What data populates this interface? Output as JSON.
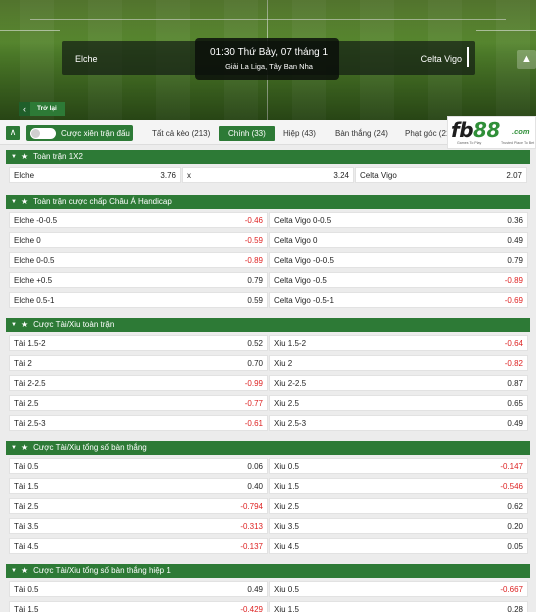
{
  "match": {
    "home_team": "Elche",
    "away_team": "Celta Vigo",
    "kickoff": "01:30 Thứ Bảy, 07 tháng 1",
    "league": "Giải La Liga, Tây Ban Nha"
  },
  "back_label": "Trở lại",
  "combo_toggle": {
    "label": "Cược xiên trận đấu",
    "on": false
  },
  "tabs": [
    {
      "label": "Tất cả kèo (213)",
      "active": false
    },
    {
      "label": "Chính (33)",
      "active": true
    },
    {
      "label": "Hiệp (43)",
      "active": false
    },
    {
      "label": "Bàn thắng (24)",
      "active": false
    },
    {
      "label": "Phạt góc (21",
      "active": false
    }
  ],
  "logo": {
    "fb": "fb",
    "num": "88",
    "com": ".com",
    "tag_left": "Games To Play",
    "tag_right": "Trusted Place To Bet"
  },
  "colors": {
    "accent": "#2d7a36",
    "negative": "#d22222"
  },
  "sections": [
    {
      "title": "Toàn trận 1X2",
      "columns": 3,
      "rows": [
        [
          {
            "label": "Elche",
            "odd": "3.76"
          },
          {
            "label": "x",
            "odd": "3.24"
          },
          {
            "label": "Celta Vigo",
            "odd": "2.07"
          }
        ]
      ]
    },
    {
      "title": "Toàn trận cược chấp Châu Á Handicap",
      "columns": 2,
      "rows": [
        [
          {
            "label": "Elche -0-0.5",
            "odd": "-0.46"
          },
          {
            "label": "Celta Vigo 0-0.5",
            "odd": "0.36"
          }
        ],
        [
          {
            "label": "Elche 0",
            "odd": "-0.59"
          },
          {
            "label": "Celta Vigo 0",
            "odd": "0.49"
          }
        ],
        [
          {
            "label": "Elche 0-0.5",
            "odd": "-0.89"
          },
          {
            "label": "Celta Vigo -0-0.5",
            "odd": "0.79"
          }
        ],
        [
          {
            "label": "Elche +0.5",
            "odd": "0.79"
          },
          {
            "label": "Celta Vigo -0.5",
            "odd": "-0.89"
          }
        ],
        [
          {
            "label": "Elche 0.5-1",
            "odd": "0.59"
          },
          {
            "label": "Celta Vigo -0.5-1",
            "odd": "-0.69"
          }
        ]
      ]
    },
    {
      "title": "Cược Tài/Xiu toàn trận",
      "columns": 2,
      "rows": [
        [
          {
            "label": "Tài 1.5-2",
            "odd": "0.52"
          },
          {
            "label": "Xiu 1.5-2",
            "odd": "-0.64"
          }
        ],
        [
          {
            "label": "Tài 2",
            "odd": "0.70"
          },
          {
            "label": "Xiu 2",
            "odd": "-0.82"
          }
        ],
        [
          {
            "label": "Tài 2-2.5",
            "odd": "-0.99"
          },
          {
            "label": "Xiu 2-2.5",
            "odd": "0.87"
          }
        ],
        [
          {
            "label": "Tài 2.5",
            "odd": "-0.77"
          },
          {
            "label": "Xiu 2.5",
            "odd": "0.65"
          }
        ],
        [
          {
            "label": "Tài 2.5-3",
            "odd": "-0.61"
          },
          {
            "label": "Xiu 2.5-3",
            "odd": "0.49"
          }
        ]
      ]
    },
    {
      "title": "Cược Tài/Xiu tổng số bàn thắng",
      "columns": 2,
      "rows": [
        [
          {
            "label": "Tài 0.5",
            "odd": "0.06"
          },
          {
            "label": "Xiu 0.5",
            "odd": "-0.147"
          }
        ],
        [
          {
            "label": "Tài 1.5",
            "odd": "0.40"
          },
          {
            "label": "Xiu 1.5",
            "odd": "-0.546"
          }
        ],
        [
          {
            "label": "Tài 2.5",
            "odd": "-0.794"
          },
          {
            "label": "Xiu 2.5",
            "odd": "0.62"
          }
        ],
        [
          {
            "label": "Tài 3.5",
            "odd": "-0.313"
          },
          {
            "label": "Xiu 3.5",
            "odd": "0.20"
          }
        ],
        [
          {
            "label": "Tài 4.5",
            "odd": "-0.137"
          },
          {
            "label": "Xiu 4.5",
            "odd": "0.05"
          }
        ]
      ]
    },
    {
      "title": "Cược Tài/Xiu tổng số bàn thắng hiệp 1",
      "columns": 2,
      "rows": [
        [
          {
            "label": "Tài 0.5",
            "odd": "0.49"
          },
          {
            "label": "Xiu 0.5",
            "odd": "-0.667"
          }
        ],
        [
          {
            "label": "Tài 1.5",
            "odd": "-0.429"
          },
          {
            "label": "Xiu 1.5",
            "odd": "0.28"
          }
        ]
      ]
    }
  ]
}
